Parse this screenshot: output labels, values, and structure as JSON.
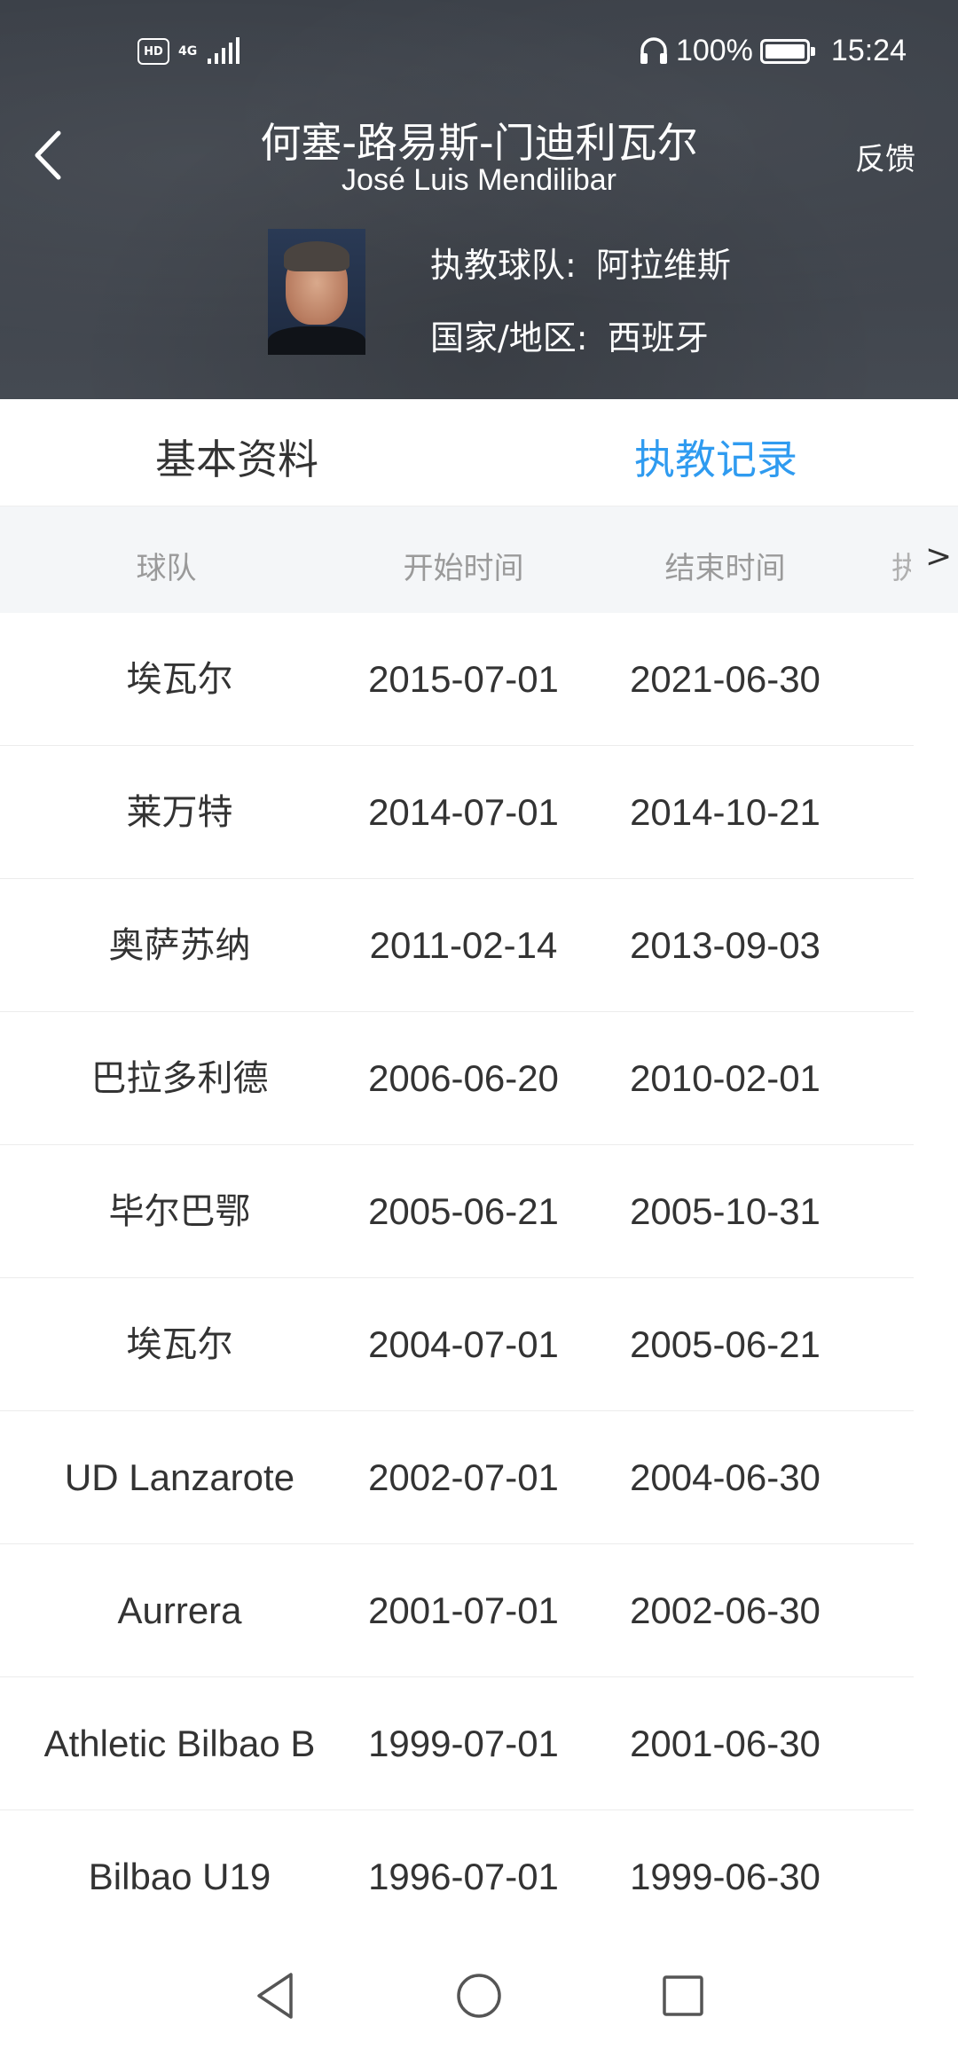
{
  "status_bar": {
    "hd_badge": "HD",
    "network": "4G",
    "battery_percent": "100%",
    "time": "15:24"
  },
  "header": {
    "name_cn": "何塞-路易斯-门迪利瓦尔",
    "name_en": "José Luis Mendilibar",
    "feedback_label": "反馈",
    "team_label": "执教球队:",
    "team_value": "阿拉维斯",
    "country_label": "国家/地区:",
    "country_value": "西班牙"
  },
  "tabs": {
    "basic": "基本资料",
    "record": "执教记录",
    "active": "record"
  },
  "table": {
    "headers": {
      "team": "球队",
      "start": "开始时间",
      "end": "结束时间",
      "more": "执",
      "scroll_arrow": ">"
    },
    "rows": [
      {
        "team": "埃瓦尔",
        "start": "2015-07-01",
        "end": "2021-06-30"
      },
      {
        "team": "莱万特",
        "start": "2014-07-01",
        "end": "2014-10-21"
      },
      {
        "team": "奥萨苏纳",
        "start": "2011-02-14",
        "end": "2013-09-03"
      },
      {
        "team": "巴拉多利德",
        "start": "2006-06-20",
        "end": "2010-02-01"
      },
      {
        "team": "毕尔巴鄂",
        "start": "2005-06-21",
        "end": "2005-10-31"
      },
      {
        "team": "埃瓦尔",
        "start": "2004-07-01",
        "end": "2005-06-21"
      },
      {
        "team": "UD Lanzarote",
        "start": "2002-07-01",
        "end": "2004-06-30"
      },
      {
        "team": "Aurrera",
        "start": "2001-07-01",
        "end": "2002-06-30"
      },
      {
        "team": "Athletic Bilbao B",
        "start": "1999-07-01",
        "end": "2001-06-30"
      },
      {
        "team": "Bilbao U19",
        "start": "1996-07-01",
        "end": "1999-06-30"
      }
    ]
  },
  "colors": {
    "accent": "#2f9bf0",
    "header_bg": "#3f444c",
    "table_header_bg": "#f4f6f8"
  }
}
